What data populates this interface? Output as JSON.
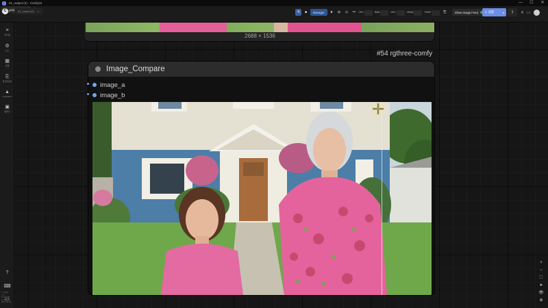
{
  "window": {
    "title": "01_output (2) - ComfyUI",
    "controls": [
      "—",
      "☐",
      "✕"
    ]
  },
  "tabs": {
    "items": [
      {
        "label": "01_output (2)",
        "close": "×"
      }
    ],
    "add": "+"
  },
  "brand": {
    "letter": "C",
    "caret": "▾"
  },
  "subtab": {
    "label": "01_output (2)",
    "close": "×"
  },
  "toolbar": {
    "manager_label": "Manager",
    "meters": [
      {
        "label": "CPU",
        "level": 0.1
      },
      {
        "label": "RAM",
        "level": 0.5
      },
      {
        "label": "GPU",
        "level": 0.0
      },
      {
        "label": "VRAM",
        "level": 0.2
      },
      {
        "label": "TEMP",
        "level": 0.4
      }
    ],
    "show_feed_label": "Show Image Feed",
    "run_label": "실행",
    "queue_count": "1"
  },
  "sidebar": {
    "items": [
      {
        "icon": "≡",
        "label": "대기열"
      },
      {
        "icon": "⚙",
        "label": "노드"
      },
      {
        "icon": "▦",
        "label": "모델"
      },
      {
        "icon": "⎘",
        "label": "워크플로우"
      },
      {
        "icon": "▲",
        "label": "Templates"
      },
      {
        "icon": "▣",
        "label": "템플릿"
      }
    ],
    "bottom_icons": [
      "?",
      "⌨",
      "▭"
    ],
    "footer": [
      "T: 0.00s",
      "I: 0",
      "N: 28 [28]",
      "V: 54",
      "FPS: 60.00"
    ]
  },
  "right_tools": [
    "+",
    "−",
    "⛶",
    "➤",
    "👁",
    "⊕"
  ],
  "prev_node": {
    "size_label": "2688 × 1536"
  },
  "compare_node": {
    "badge": "#54 rgthree-comfy",
    "title": "Image_Compare",
    "inputs": [
      "image_a",
      "image_b"
    ],
    "compare_position": 0.852
  },
  "colors": {
    "accent": "#6c8ee6",
    "input_slot": "#6da6e8",
    "manager_bg": "#2c5696"
  }
}
